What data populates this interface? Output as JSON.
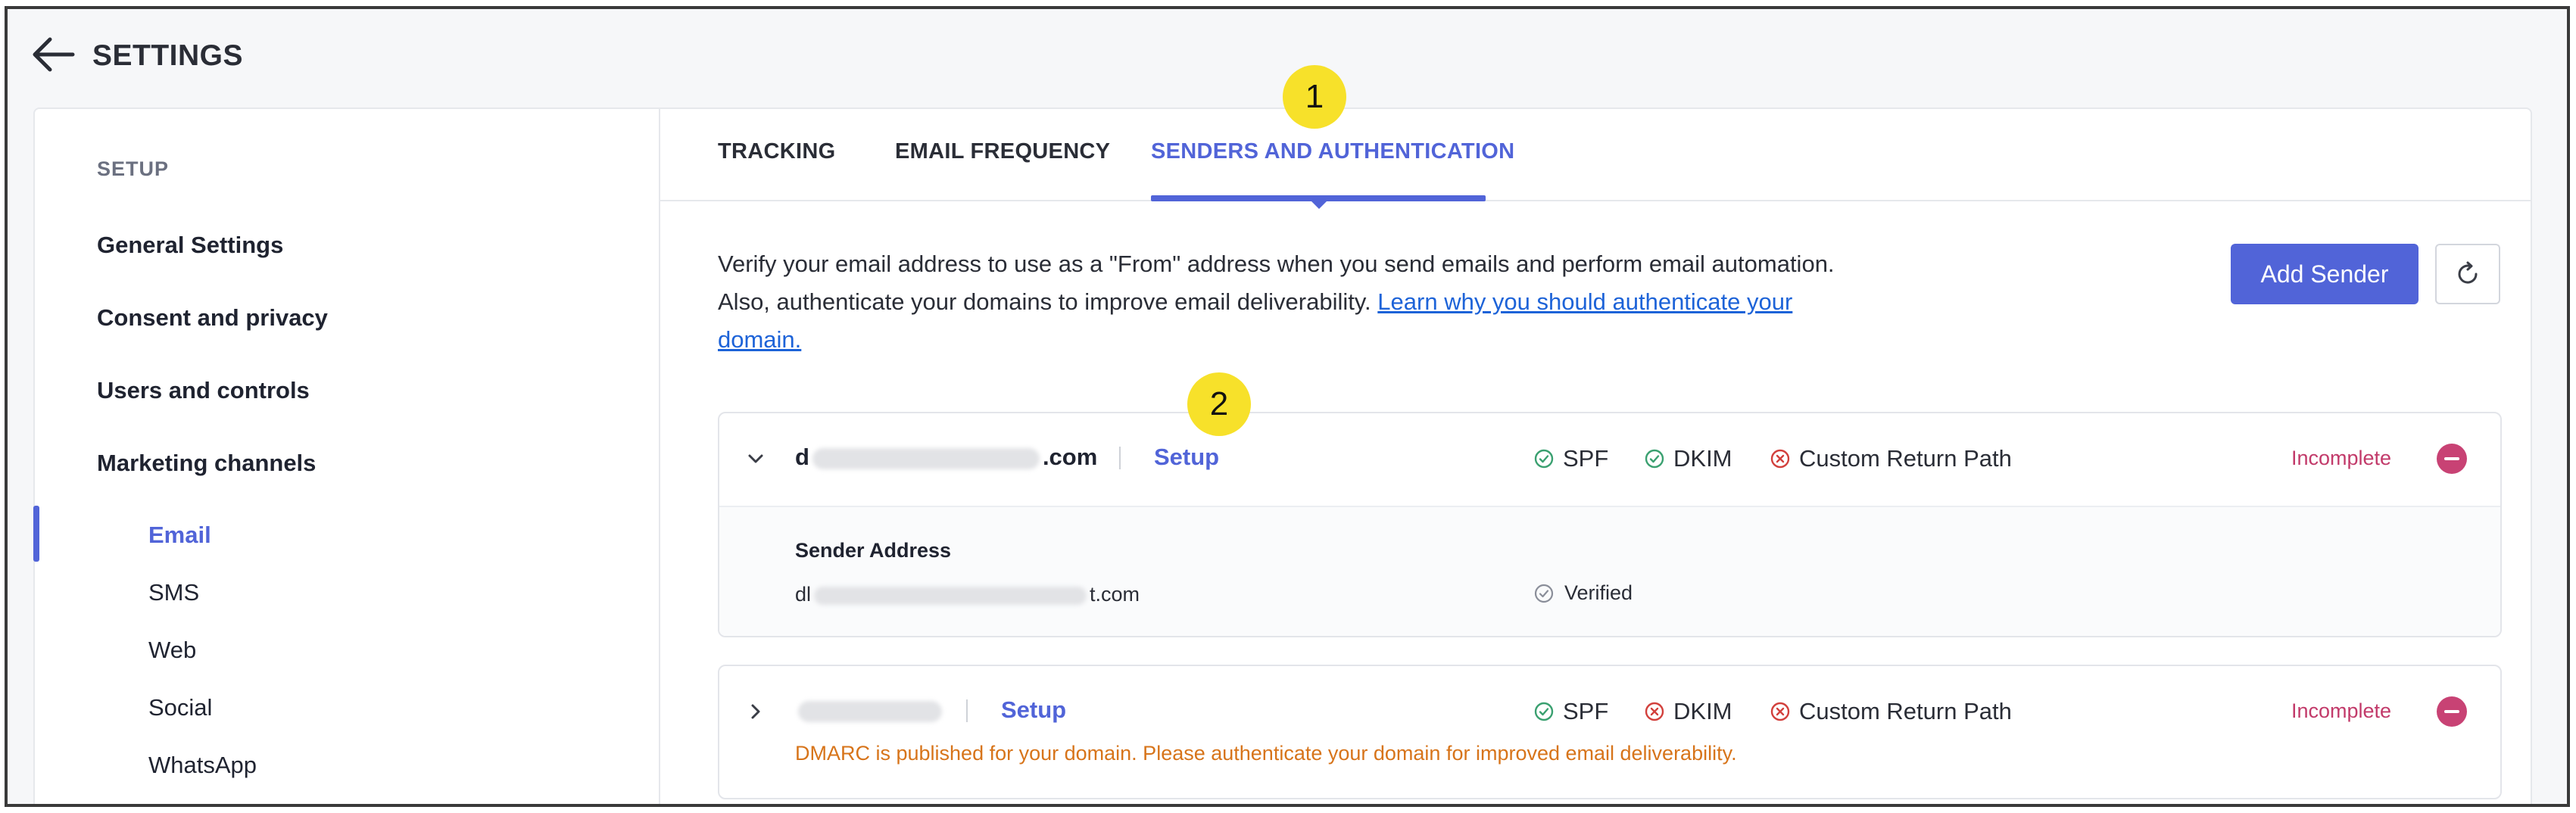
{
  "header": {
    "title": "SETTINGS"
  },
  "sidebar": {
    "section_label": "SETUP",
    "items": [
      {
        "label": "General Settings"
      },
      {
        "label": "Consent and privacy"
      },
      {
        "label": "Users and controls"
      },
      {
        "label": "Marketing channels"
      }
    ],
    "channels": [
      {
        "label": "Email",
        "active": true
      },
      {
        "label": "SMS"
      },
      {
        "label": "Web"
      },
      {
        "label": "Social"
      },
      {
        "label": "WhatsApp"
      }
    ]
  },
  "tabs": [
    {
      "label": "TRACKING"
    },
    {
      "label": "EMAIL FREQUENCY"
    },
    {
      "label": "SENDERS AND AUTHENTICATION",
      "active": true
    }
  ],
  "markers": [
    "1",
    "2"
  ],
  "description": {
    "line1": "Verify your email address to use as a \"From\" address when you send emails and perform email automation.",
    "line2": "Also, authenticate your domains to improve email deliverability.",
    "link": "Learn why you should authenticate your domain."
  },
  "actions": {
    "add_sender": "Add Sender",
    "refresh_icon": "refresh-icon"
  },
  "senders": [
    {
      "domain_prefix": "d",
      "domain_suffix": ".com",
      "setup": "Setup",
      "checks": [
        {
          "label": "SPF",
          "status": "ok"
        },
        {
          "label": "DKIM",
          "status": "ok"
        },
        {
          "label": "Custom Return Path",
          "status": "fail"
        }
      ],
      "status": "Incomplete",
      "detail": {
        "label": "Sender Address",
        "value_prefix": "dl",
        "value_suffix": "t.com",
        "verified": "Verified"
      }
    },
    {
      "setup": "Setup",
      "checks": [
        {
          "label": "SPF",
          "status": "ok"
        },
        {
          "label": "DKIM",
          "status": "fail"
        },
        {
          "label": "Custom Return Path",
          "status": "fail"
        }
      ],
      "status": "Incomplete",
      "warning": "DMARC is published for your domain. Please authenticate your domain for improved email deliverability."
    }
  ],
  "colors": {
    "accent": "#5164d8",
    "ok": "#3aa070",
    "fail": "#d2403c",
    "incomplete": "#c23a6a",
    "warning": "#d7741a",
    "marker": "#f7e12a"
  }
}
